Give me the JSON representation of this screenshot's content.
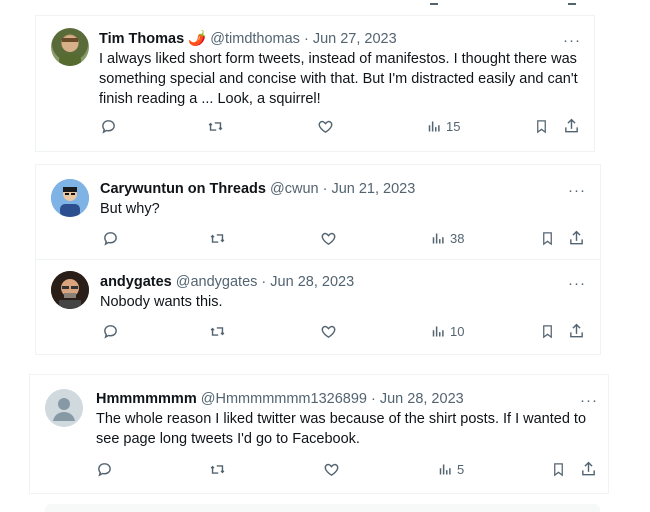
{
  "tweets": [
    {
      "name": "Tim Thomas 🌶️",
      "meta": "@timdthomas · Jun 27, 2023",
      "text": "I always liked short form tweets, instead of manifestos. I thought there was something special and concise with that. But I'm distracted easily and can't finish reading a ... Look, a squirrel!",
      "views": "15"
    },
    {
      "name": "Carywuntun on Threads",
      "meta": "@cwun · Jun 21, 2023",
      "text": "But why?",
      "views": "38"
    },
    {
      "name": "andygates",
      "meta": "@andygates · Jun 28, 2023",
      "text": "Nobody wants this.",
      "views": "10"
    },
    {
      "name": "Hmmmmmmm",
      "meta": "@Hmmmmmmm1326899 · Jun 28, 2023",
      "text": "The whole reason I liked twitter was because of the shirt posts.  If I wanted to see page long tweets I'd go to Facebook.",
      "views": "5"
    }
  ],
  "more_label": "···",
  "icons": [
    "reply-icon",
    "retweet-icon",
    "like-icon",
    "views-icon",
    "bookmark-icon",
    "share-icon"
  ],
  "colors": {
    "text": "#0f1419",
    "secondary": "#536471",
    "border": "#eff3f4",
    "pepper": "#e0245e"
  }
}
